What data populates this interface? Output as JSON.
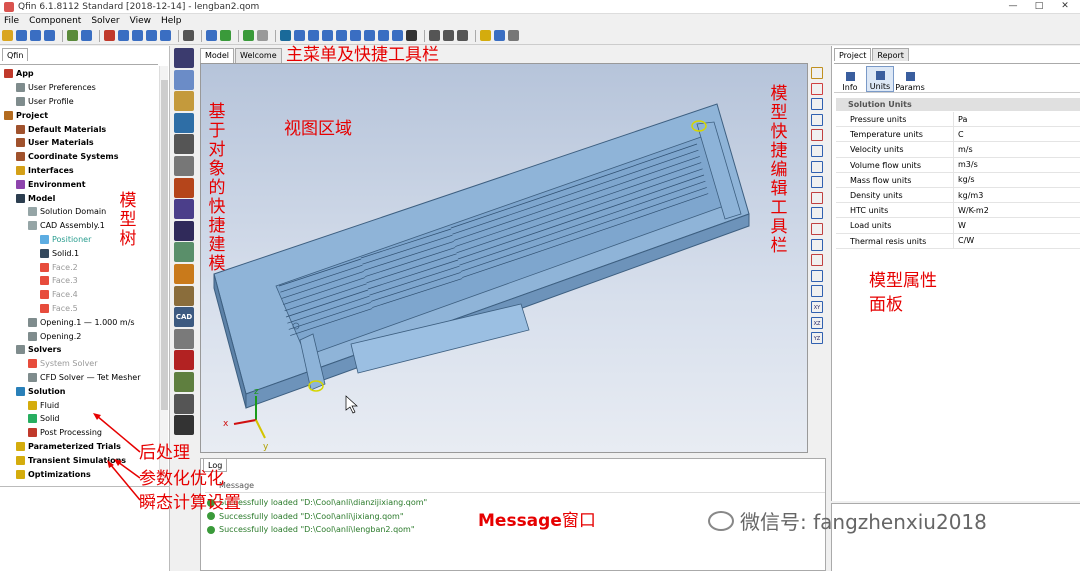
{
  "window": {
    "title": "Qfin 6.1.8112 Standard [2018-12-14] - lengban2.qom",
    "controls": [
      "—",
      "□",
      "✕"
    ]
  },
  "menu": [
    "File",
    "Component",
    "Solver",
    "View",
    "Help"
  ],
  "left_panel": {
    "tab": "Qfin",
    "tree": [
      {
        "label": "App",
        "indent": 0,
        "style": "bold",
        "icon": "#c0392b"
      },
      {
        "label": "User Preferences",
        "indent": 1,
        "style": "normal",
        "icon": "#7f8c8d"
      },
      {
        "label": "User Profile",
        "indent": 1,
        "style": "normal",
        "icon": "#7f8c8d"
      },
      {
        "label": "Project",
        "indent": 0,
        "style": "bold",
        "icon": "#b36b1f"
      },
      {
        "label": "Default Materials",
        "indent": 1,
        "style": "bold",
        "icon": "#a0522d"
      },
      {
        "label": "User Materials",
        "indent": 1,
        "style": "bold",
        "icon": "#a0522d"
      },
      {
        "label": "Coordinate Systems",
        "indent": 1,
        "style": "bold",
        "icon": "#a0522d"
      },
      {
        "label": "Interfaces",
        "indent": 1,
        "style": "bold",
        "icon": "#d4a017"
      },
      {
        "label": "Environment",
        "indent": 1,
        "style": "bold",
        "icon": "#8e44ad"
      },
      {
        "label": "Model",
        "indent": 1,
        "style": "bold",
        "icon": "#2c3e50"
      },
      {
        "label": "Solution Domain",
        "indent": 2,
        "style": "normal",
        "icon": "#95a5a6"
      },
      {
        "label": "CAD Assembly.1",
        "indent": 2,
        "style": "normal",
        "icon": "#95a5a6"
      },
      {
        "label": "Positioner",
        "indent": 3,
        "style": "teal",
        "icon": "#5dade2"
      },
      {
        "label": "Solid.1",
        "indent": 3,
        "style": "normal",
        "icon": "#34495e"
      },
      {
        "label": "Face.2",
        "indent": 3,
        "style": "gray",
        "icon": "#e74c3c"
      },
      {
        "label": "Face.3",
        "indent": 3,
        "style": "gray",
        "icon": "#e74c3c"
      },
      {
        "label": "Face.4",
        "indent": 3,
        "style": "gray",
        "icon": "#e74c3c"
      },
      {
        "label": "Face.5",
        "indent": 3,
        "style": "gray",
        "icon": "#e74c3c"
      },
      {
        "label": "Opening.1 — 1.000 m/s",
        "indent": 2,
        "style": "normal",
        "icon": "#7f8c8d"
      },
      {
        "label": "Opening.2",
        "indent": 2,
        "style": "normal",
        "icon": "#7f8c8d"
      },
      {
        "label": "Solvers",
        "indent": 1,
        "style": "bold",
        "icon": "#7f8c8d"
      },
      {
        "label": "System Solver",
        "indent": 2,
        "style": "gray",
        "icon": "#e74c3c"
      },
      {
        "label": "CFD Solver — Tet Mesher",
        "indent": 2,
        "style": "normal",
        "icon": "#7f8c8d"
      },
      {
        "label": "Solution",
        "indent": 1,
        "style": "bold",
        "icon": "#2980b9"
      },
      {
        "label": "Fluid",
        "indent": 2,
        "style": "normal",
        "icon": "#d4ac0d"
      },
      {
        "label": "Solid",
        "indent": 2,
        "style": "normal",
        "icon": "#27ae60"
      },
      {
        "label": "Post Processing",
        "indent": 2,
        "style": "normal",
        "icon": "#c0392b"
      },
      {
        "label": "Parameterized Trials",
        "indent": 1,
        "style": "bold",
        "icon": "#d4ac0d"
      },
      {
        "label": "Transient Simulations",
        "indent": 1,
        "style": "bold",
        "icon": "#d4ac0d"
      },
      {
        "label": "Optimizations",
        "indent": 1,
        "style": "bold",
        "icon": "#d4ac0d"
      }
    ]
  },
  "object_toolbar": [
    {
      "name": "block",
      "color": "#3b3b6e",
      "text": ""
    },
    {
      "name": "cylinder",
      "color": "#6b8cc7",
      "text": ""
    },
    {
      "name": "heatsink",
      "color": "#c49a3c",
      "text": ""
    },
    {
      "name": "source",
      "color": "#2e6ea6",
      "text": ""
    },
    {
      "name": "fan",
      "color": "#555",
      "text": ""
    },
    {
      "name": "vent",
      "color": "#777",
      "text": ""
    },
    {
      "name": "pcb",
      "color": "#b5451b",
      "text": ""
    },
    {
      "name": "enclosure",
      "color": "#4b3e8a",
      "text": ""
    },
    {
      "name": "solid",
      "color": "#302a5a",
      "text": ""
    },
    {
      "name": "region",
      "color": "#5a8f6a",
      "text": ""
    },
    {
      "name": "component",
      "color": "#c97a1b",
      "text": ""
    },
    {
      "name": "assembly",
      "color": "#8a6d3b",
      "text": ""
    },
    {
      "name": "cad",
      "color": "#3d5a80",
      "text": "CAD"
    },
    {
      "name": "layers",
      "color": "#7a7a7a",
      "text": ""
    },
    {
      "name": "bars",
      "color": "#b22222",
      "text": ""
    },
    {
      "name": "board",
      "color": "#5f7f3f",
      "text": ""
    },
    {
      "name": "chip",
      "color": "#555",
      "text": ""
    },
    {
      "name": "probe",
      "color": "#333",
      "text": ""
    }
  ],
  "view_tabs": [
    "Model",
    "Welcome"
  ],
  "axes": {
    "x": "x",
    "y": "y",
    "z": "z"
  },
  "right_vtool": [
    "",
    "",
    "",
    "",
    "",
    "",
    "",
    "",
    "",
    "",
    "",
    "",
    "",
    "",
    "",
    "XY",
    "XZ",
    "YZ"
  ],
  "log": {
    "tab": "Log",
    "header": "Message",
    "lines": [
      "Successfully loaded \"D:\\Cool\\anli\\dianzijixiang.qom\"",
      "Successfully loaded \"D:\\Cool\\anli\\jixiang.qom\"",
      "Successfully loaded \"D:\\Cool\\anli\\lengban2.qom\""
    ]
  },
  "right_panel": {
    "tabs": [
      "Project",
      "Report"
    ],
    "subtabs": [
      "Info",
      "Units",
      "Params"
    ],
    "section": "Solution Units",
    "props": [
      {
        "k": "Pressure units",
        "v": "Pa"
      },
      {
        "k": "Temperature units",
        "v": "C"
      },
      {
        "k": "Velocity units",
        "v": "m/s"
      },
      {
        "k": "Volume flow units",
        "v": "m3/s"
      },
      {
        "k": "Mass flow units",
        "v": "kg/s"
      },
      {
        "k": "Density units",
        "v": "kg/m3"
      },
      {
        "k": "HTC units",
        "v": "W/K-m2"
      },
      {
        "k": "Load units",
        "v": "W"
      },
      {
        "k": "Thermal resis units",
        "v": "C/W"
      }
    ]
  },
  "annotations": {
    "main_menu": "主菜单及快捷工具栏",
    "view_area": "视图区域",
    "object_modeling": "基于对象的快捷建模",
    "model_tree": "模型树",
    "model_edit_toolbar": "模型快捷编辑工具栏",
    "model_props_1": "模型属性",
    "model_props_2": "面板",
    "post_processing": "后处理",
    "param_opt": "参数化优化",
    "transient": "瞬态计算设置",
    "message_prefix": "Message",
    "message_suffix": "窗口",
    "wechat": "微信号: fangzhenxiu2018"
  }
}
